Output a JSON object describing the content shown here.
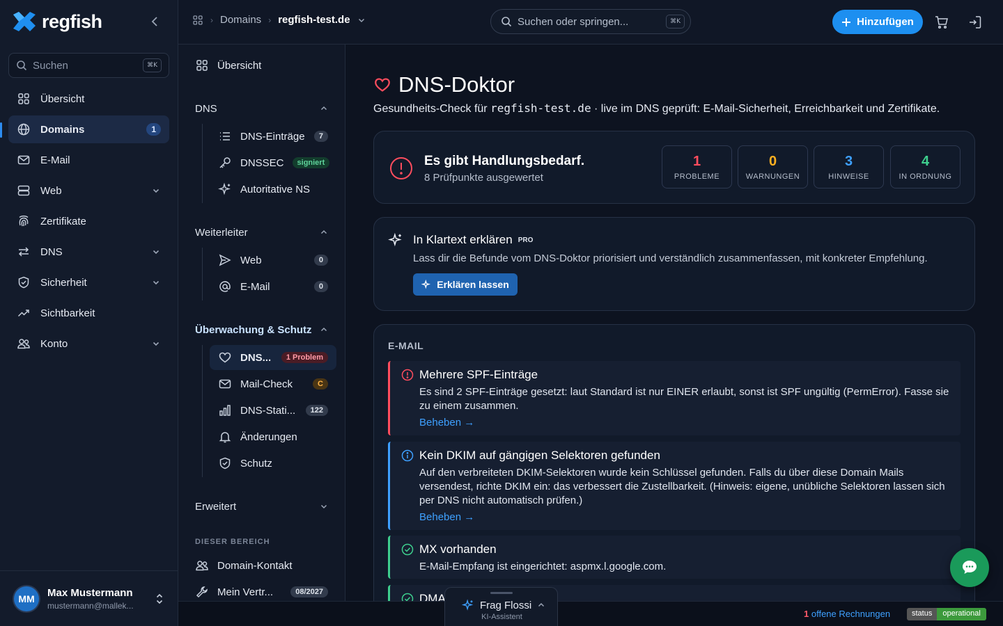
{
  "brand": {
    "name": "regfish"
  },
  "sidebar": {
    "search_placeholder": "Suchen",
    "search_shortcut": "⌘K",
    "items": [
      {
        "label": "Übersicht",
        "icon": "grid-icon"
      },
      {
        "label": "Domains",
        "icon": "globe-icon",
        "badge": "1",
        "active": true
      },
      {
        "label": "E-Mail",
        "icon": "mail-icon"
      },
      {
        "label": "Web",
        "icon": "server-icon",
        "expandable": true
      },
      {
        "label": "Zertifikate",
        "icon": "fingerprint-icon"
      },
      {
        "label": "DNS",
        "icon": "arrows-icon",
        "expandable": true
      },
      {
        "label": "Sicherheit",
        "icon": "shield-icon",
        "expandable": true
      },
      {
        "label": "Sichtbarkeit",
        "icon": "trend-icon"
      },
      {
        "label": "Konto",
        "icon": "users-icon",
        "expandable": true
      }
    ],
    "user": {
      "initials": "MM",
      "name": "Max Mustermann",
      "email": "mustermann@mallek..."
    }
  },
  "topbar": {
    "breadcrumb": {
      "section": "Domains",
      "current": "regfish-test.de"
    },
    "search_placeholder": "Suchen oder springen...",
    "search_shortcut": "⌘K",
    "add_label": "Hinzufügen"
  },
  "subnav": {
    "overview": "Übersicht",
    "dns": {
      "title": "DNS",
      "items": [
        {
          "label": "DNS-Einträge",
          "badge": "7"
        },
        {
          "label": "DNSSEC",
          "badge": "signiert"
        },
        {
          "label": "Autoritative NS"
        }
      ]
    },
    "forward": {
      "title": "Weiterleiter",
      "items": [
        {
          "label": "Web",
          "badge": "0"
        },
        {
          "label": "E-Mail",
          "badge": "0"
        }
      ]
    },
    "monitor": {
      "title": "Überwachung & Schutz",
      "items": [
        {
          "label": "DNS...",
          "badge": "1 Problem",
          "active": true
        },
        {
          "label": "Mail-Check",
          "badge": "C"
        },
        {
          "label": "DNS-Stati...",
          "badge": "122"
        },
        {
          "label": "Änderungen"
        },
        {
          "label": "Schutz"
        }
      ]
    },
    "advanced": "Erweitert",
    "area_label": "DIESER BEREICH",
    "area_items": [
      {
        "label": "Domain-Kontakt"
      },
      {
        "label": "Mein Vertr...",
        "badge": "08/2027"
      }
    ]
  },
  "main": {
    "title": "DNS-Doktor",
    "subtitle_pre": "Gesundheits-Check für ",
    "subtitle_domain": "regfish-test.de",
    "subtitle_post": " · live im DNS geprüft: E-Mail-Sicherheit, Erreichbarkeit und Zertifikate.",
    "summary": {
      "headline": "Es gibt Handlungsbedarf.",
      "sub": "8 Prüfpunkte ausgewertet",
      "stats": [
        {
          "value": "1",
          "label": "PROBLEME",
          "color": "#ff4d5e"
        },
        {
          "value": "0",
          "label": "WARNUNGEN",
          "color": "#ffb020"
        },
        {
          "value": "3",
          "label": "HINWEISE",
          "color": "#3ea0ff"
        },
        {
          "value": "4",
          "label": "IN ORDNUNG",
          "color": "#3ecf8e"
        }
      ]
    },
    "explain": {
      "title": "In Klartext erklären",
      "pro": "PRO",
      "text": "Lass dir die Befunde vom DNS-Doktor priorisiert und verständlich zusammenfassen, mit konkreter Empfehlung.",
      "button": "Erklären lassen"
    },
    "email_section": {
      "label": "E-MAIL",
      "findings": [
        {
          "title": "Mehrere SPF-Einträge",
          "text": "Es sind 2 SPF-Einträge gesetzt: laut Standard ist nur EINER erlaubt, sonst ist SPF ungültig (PermError). Fasse sie zu einem zusammen.",
          "link": "Beheben →",
          "severity": "error",
          "color": "#ff4d5e"
        },
        {
          "title": "Kein DKIM auf gängigen Selektoren gefunden",
          "text": "Auf den verbreiteten DKIM-Selektoren wurde kein Schlüssel gefunden. Falls du über diese Domain Mails versendest, richte DKIM ein: das verbessert die Zustellbarkeit. (Hinweis: eigene, unübliche Selektoren lassen sich per DNS nicht automatisch prüfen.)",
          "link": "Beheben →",
          "severity": "info",
          "color": "#3ea0ff"
        },
        {
          "title": "MX vorhanden",
          "text": "E-Mail-Empfang ist eingerichtet: aspmx.l.google.com.",
          "severity": "ok",
          "color": "#3ecf8e"
        },
        {
          "title": "DMA",
          "severity": "ok",
          "color": "#3ecf8e"
        }
      ]
    }
  },
  "bottombar": {
    "invoice_count": "1",
    "invoice_text": " offene Rechnungen",
    "status_key": "status",
    "status_value": "operational"
  },
  "assistant": {
    "title": "Frag Flossi",
    "subtitle": "KI-Assistent"
  }
}
